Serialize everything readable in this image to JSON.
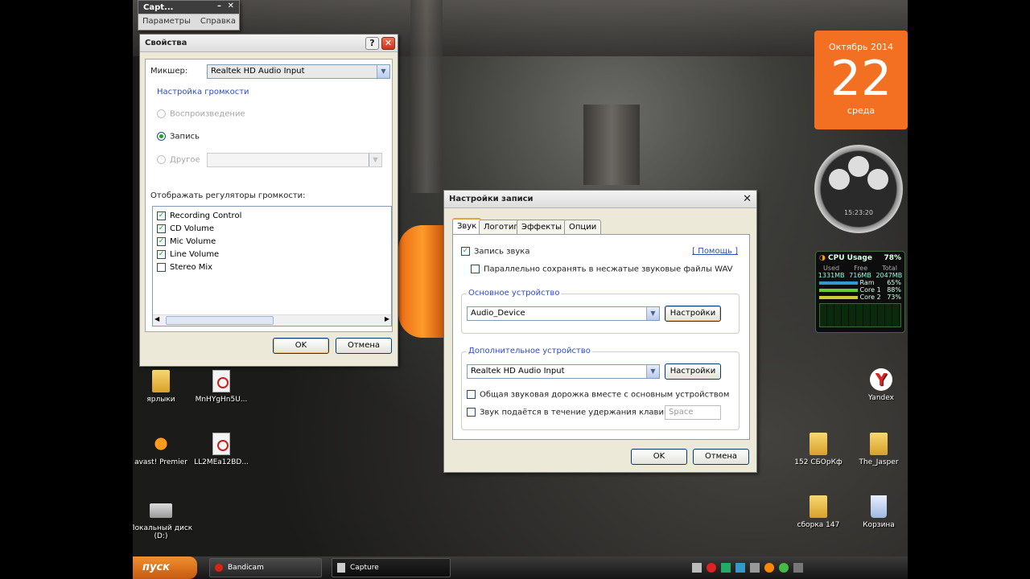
{
  "capture_window": {
    "title": "Capt...",
    "menu": [
      "Параметры",
      "Справка"
    ]
  },
  "properties_dialog": {
    "title": "Свойства",
    "help": "?",
    "mixer_label": "Микшер:",
    "mixer_value": "Realtek HD Audio Input",
    "volume_link": "Настройка громкости",
    "radio_playback": "Воспроизведение",
    "radio_record": "Запись",
    "radio_other": "Другое",
    "controls_label": "Отображать регуляторы громкости:",
    "controls": [
      {
        "label": "Recording Control",
        "checked": true
      },
      {
        "label": "CD Volume",
        "checked": true
      },
      {
        "label": "Mic Volume",
        "checked": true
      },
      {
        "label": "Line Volume",
        "checked": true
      },
      {
        "label": "Stereo Mix",
        "checked": false
      }
    ],
    "ok": "OK",
    "cancel": "Отмена"
  },
  "record_dialog": {
    "title": "Настройки записи",
    "tabs": [
      "Звук",
      "Логотип",
      "Эффекты",
      "Опции"
    ],
    "record_sound": "Запись звука",
    "help_link": "[ Помощь ]",
    "save_wav": "Параллельно сохранять в несжатые звуковые файлы WAV",
    "primary_group": "Основное устройство",
    "primary_device": "Audio_Device",
    "settings_btn": "Настройки",
    "secondary_group": "Дополнительное устройство",
    "secondary_device": "Realtek HD Audio Input",
    "mix_track": "Общая звуковая дорожка вместе с основным устройством",
    "hold_key": "Звук подаётся в течение удержания клавиши",
    "hold_key_value": "Space",
    "ok": "OK",
    "cancel": "Отмена"
  },
  "calendar": {
    "month": "Октябрь 2014",
    "day": "22",
    "weekday": "среда",
    "color": "#f36f21"
  },
  "clock": {
    "time": "15:23:20"
  },
  "cpu": {
    "title": "CPU Usage",
    "percent": "78%",
    "used": "1331MB",
    "free": "716MB",
    "total": "2047MB",
    "labels": [
      "Used",
      "Free",
      "Total"
    ],
    "rows": [
      {
        "name": "Ram",
        "value": "65%"
      },
      {
        "name": "Core 1",
        "value": "88%"
      },
      {
        "name": "Core 2",
        "value": "73%"
      }
    ]
  },
  "desktop_icons": [
    {
      "label": "ярлыки"
    },
    {
      "label": "MnHYgHn5U..."
    },
    {
      "label": "avast! Premier"
    },
    {
      "label": "LL2MEa12BD..."
    },
    {
      "label": "Локальный диск (D:)"
    },
    {
      "label": "Yandex"
    },
    {
      "label": "152 СБОрКф"
    },
    {
      "label": "The_Jasper"
    },
    {
      "label": "сборка 147"
    },
    {
      "label": "Корзина"
    }
  ],
  "taskbar": {
    "start": "пуск",
    "items": [
      "Bandicam",
      "Capture"
    ]
  }
}
